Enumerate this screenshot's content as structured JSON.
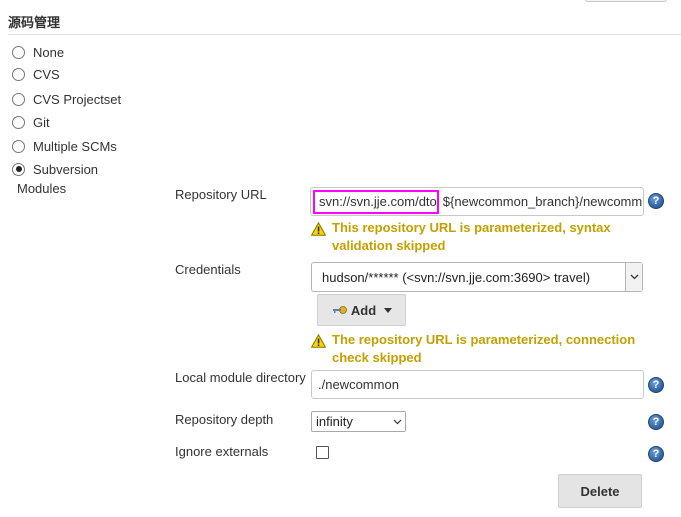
{
  "section": {
    "title": "源码管理"
  },
  "scm_options": [
    {
      "label": "None",
      "selected": false
    },
    {
      "label": "CVS",
      "selected": false
    },
    {
      "label": "CVS Projectset",
      "selected": false
    },
    {
      "label": "Git",
      "selected": false
    },
    {
      "label": "Multiple SCMs",
      "selected": false
    },
    {
      "label": "Subversion",
      "selected": true
    }
  ],
  "modules": {
    "label": "Modules",
    "repository_url": {
      "label": "Repository URL",
      "highlighted_part": "svn://svn.jje.com/dto",
      "rest_part": "${newcommon_branch}/newcomm",
      "warning": "This repository URL is parameterized, syntax validation skipped"
    },
    "credentials": {
      "label": "Credentials",
      "selected": "hudson/****** (<svn://svn.jje.com:3690> travel)",
      "add_label": "Add",
      "warning": "The repository URL is parameterized, connection check skipped"
    },
    "local_module_directory": {
      "label": "Local module directory",
      "value": "./newcommon"
    },
    "repository_depth": {
      "label": "Repository depth",
      "value": "infinity"
    },
    "ignore_externals": {
      "label": "Ignore externals",
      "checked": false
    },
    "delete_label": "Delete"
  },
  "icons": {
    "help": "help-icon",
    "warning": "warning-icon",
    "key": "key-icon"
  },
  "colors": {
    "warning_text": "#c4a000",
    "highlight_border": "#ff00ff",
    "help_icon": "#2c5f9e"
  }
}
